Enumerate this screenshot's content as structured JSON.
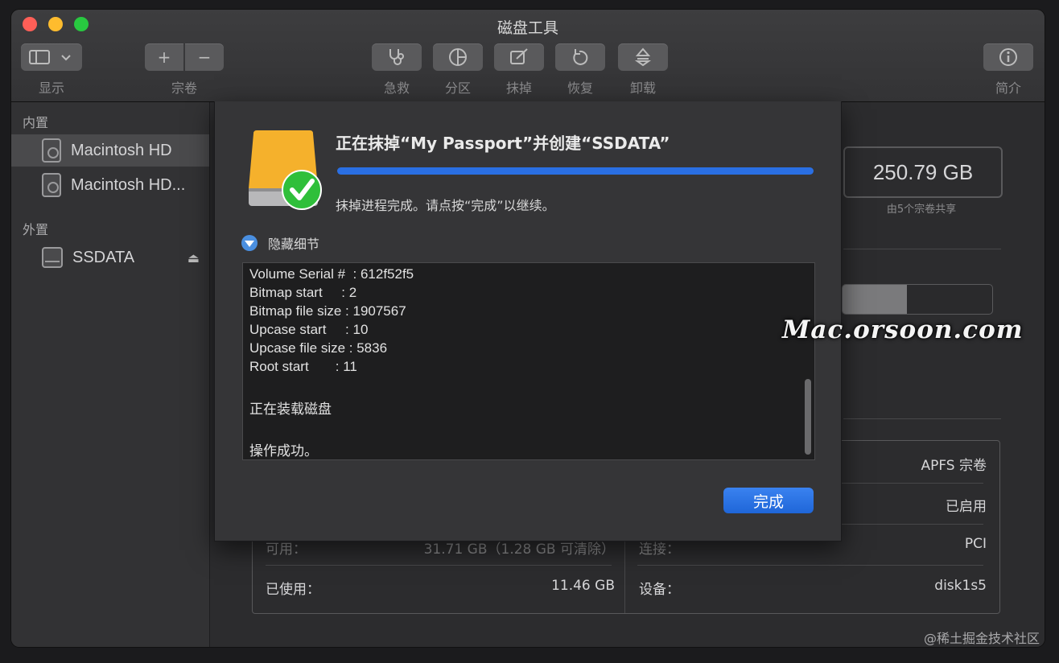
{
  "window": {
    "title": "磁盘工具",
    "traffic_colors": {
      "close": "#ff5f57",
      "minimize": "#febc2e",
      "zoom": "#28c840"
    }
  },
  "toolbar": {
    "view_label": "显示",
    "volume_label": "宗卷",
    "volume_add": "+",
    "volume_remove": "−",
    "first_aid_label": "急救",
    "partition_label": "分区",
    "erase_label": "抹掉",
    "restore_label": "恢复",
    "unmount_label": "卸载",
    "info_label": "简介"
  },
  "sidebar": {
    "internal_header": "内置",
    "internal_items": [
      {
        "label": "Macintosh HD"
      },
      {
        "label": "Macintosh HD..."
      }
    ],
    "external_header": "外置",
    "external_items": [
      {
        "label": "SSDATA"
      }
    ],
    "eject_glyph": "⏏"
  },
  "main": {
    "capacity": "250.79 GB",
    "capacity_caption": "由5个宗卷共享",
    "usage_fraction": 0.43,
    "info_rows": {
      "left": [
        {
          "label": "可用：",
          "value": "31.71 GB（1.28 GB 可清除）"
        },
        {
          "label": "已使用：",
          "value": "11.46 GB"
        }
      ],
      "right": [
        {
          "label": "",
          "value": "APFS 宗卷"
        },
        {
          "label": "",
          "value": "已启用"
        },
        {
          "label": "连接：",
          "value": "PCI"
        },
        {
          "label": "设备：",
          "value": "disk1s5"
        }
      ]
    }
  },
  "sheet": {
    "title": "正在抹掉“My Passport”并创建“SSDATA”",
    "progress": 1.0,
    "status": "抹掉进程完成。请点按“完成”以继续。",
    "details_toggle": "隐藏细节",
    "log_lines": [
      "Volume Serial #  : 612f52f5",
      "Bitmap start     : 2",
      "Bitmap file size : 1907567",
      "Upcase start     : 10",
      "Upcase file size : 5836",
      "Root start       : 11",
      "",
      "正在装载磁盘",
      "",
      "操作成功。"
    ],
    "done_button": "完成"
  },
  "watermarks": {
    "site": "Mac.orsoon.com",
    "community": "@稀土掘金技术社区"
  },
  "colors": {
    "accent": "#2a6fe3",
    "check_green": "#2fbf3a",
    "drive_orange": "#f5b12c"
  }
}
